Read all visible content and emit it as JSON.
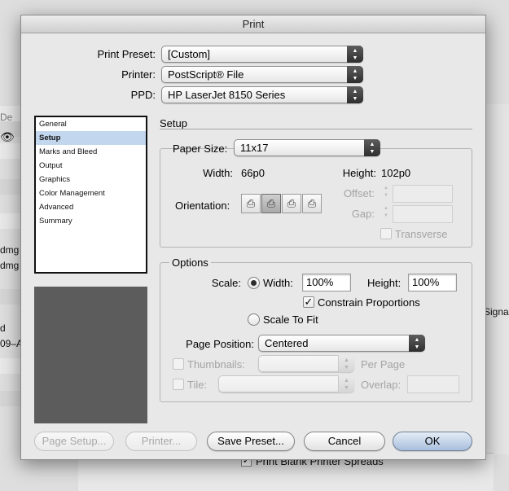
{
  "background": {
    "partial_labels": [
      "De",
      "dmg",
      "dmg",
      "d",
      "09–A"
    ],
    "right_labels": [
      "Signa"
    ],
    "bottom_checkbox_label": "Print Blank Printer Spreads"
  },
  "dialog": {
    "title": "Print",
    "preset": {
      "label": "Print Preset:",
      "value": "[Custom]"
    },
    "printer": {
      "label": "Printer:",
      "value": "PostScript® File"
    },
    "ppd": {
      "label": "PPD:",
      "value": "HP LaserJet 8150 Series"
    },
    "nav": {
      "items": [
        "General",
        "Setup",
        "Marks and Bleed",
        "Output",
        "Graphics",
        "Color Management",
        "Advanced",
        "Summary"
      ],
      "selected": "Setup"
    },
    "section_title": "Setup",
    "paper": {
      "size_label": "Paper Size:",
      "size_value": "11x17",
      "width_label": "Width:",
      "width_value": "66p0",
      "height_label": "Height:",
      "height_value": "102p0",
      "orientation_label": "Orientation:",
      "offset_label": "Offset:",
      "gap_label": "Gap:",
      "transverse_label": "Transverse"
    },
    "options": {
      "group_label": "Options",
      "scale_label": "Scale:",
      "width_label": "Width:",
      "width_value": "100%",
      "height_label": "Height:",
      "height_value": "100%",
      "constrain_label": "Constrain Proportions",
      "scale_to_fit_label": "Scale To Fit",
      "page_position_label": "Page Position:",
      "page_position_value": "Centered",
      "thumbnails_label": "Thumbnails:",
      "per_page_label": "Per Page",
      "tile_label": "Tile:",
      "overlap_label": "Overlap:"
    },
    "buttons": {
      "page_setup": "Page Setup...",
      "printer": "Printer...",
      "save_preset": "Save Preset...",
      "cancel": "Cancel",
      "ok": "OK"
    }
  }
}
